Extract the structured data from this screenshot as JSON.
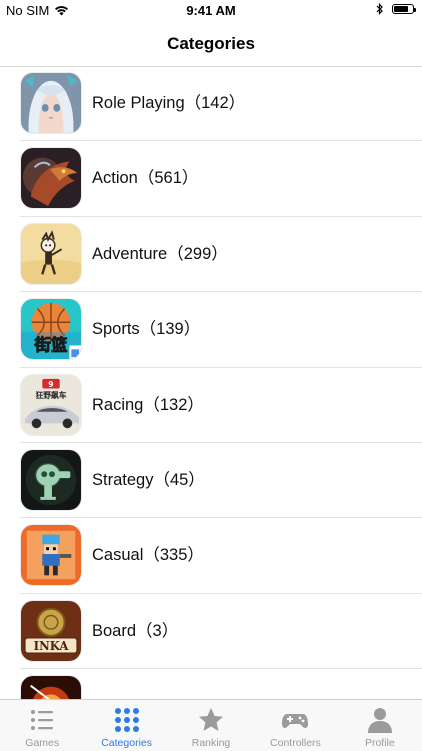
{
  "status_bar": {
    "carrier": "No SIM",
    "time": "9:41 AM",
    "battery_level": 0.8
  },
  "nav": {
    "title": "Categories"
  },
  "categories": [
    {
      "label": "Role Playing（142）",
      "icon": "anime-girl-thumbnail"
    },
    {
      "label": "Action（561）",
      "icon": "dragon-thumbnail"
    },
    {
      "label": "Adventure（299）",
      "icon": "adventure-character-thumbnail"
    },
    {
      "label": "Sports（139）",
      "icon": "basketball-thumbnail"
    },
    {
      "label": "Racing（132）",
      "icon": "race-car-thumbnail"
    },
    {
      "label": "Strategy（45）",
      "icon": "robot-thumbnail"
    },
    {
      "label": "Casual（335）",
      "icon": "pixel-hero-thumbnail"
    },
    {
      "label": "Board（3）",
      "icon": "inka-thumbnail"
    },
    {
      "label": "",
      "icon": "fire-thumbnail"
    }
  ],
  "thumb_text": {
    "sports": "街篮",
    "racing_badge": "9",
    "racing_title": "狂野飙车",
    "board": "INKA"
  },
  "tabs": [
    {
      "label": "Games",
      "icon": "list-icon",
      "active": false
    },
    {
      "label": "Categories",
      "icon": "grid-icon",
      "active": true
    },
    {
      "label": "Ranking",
      "icon": "star-icon",
      "active": false
    },
    {
      "label": "Controllers",
      "icon": "gamepad-icon",
      "active": false
    },
    {
      "label": "Profile",
      "icon": "person-icon",
      "active": false
    }
  ],
  "colors": {
    "accent": "#2c7be5",
    "inactive": "#9b9b9b"
  }
}
